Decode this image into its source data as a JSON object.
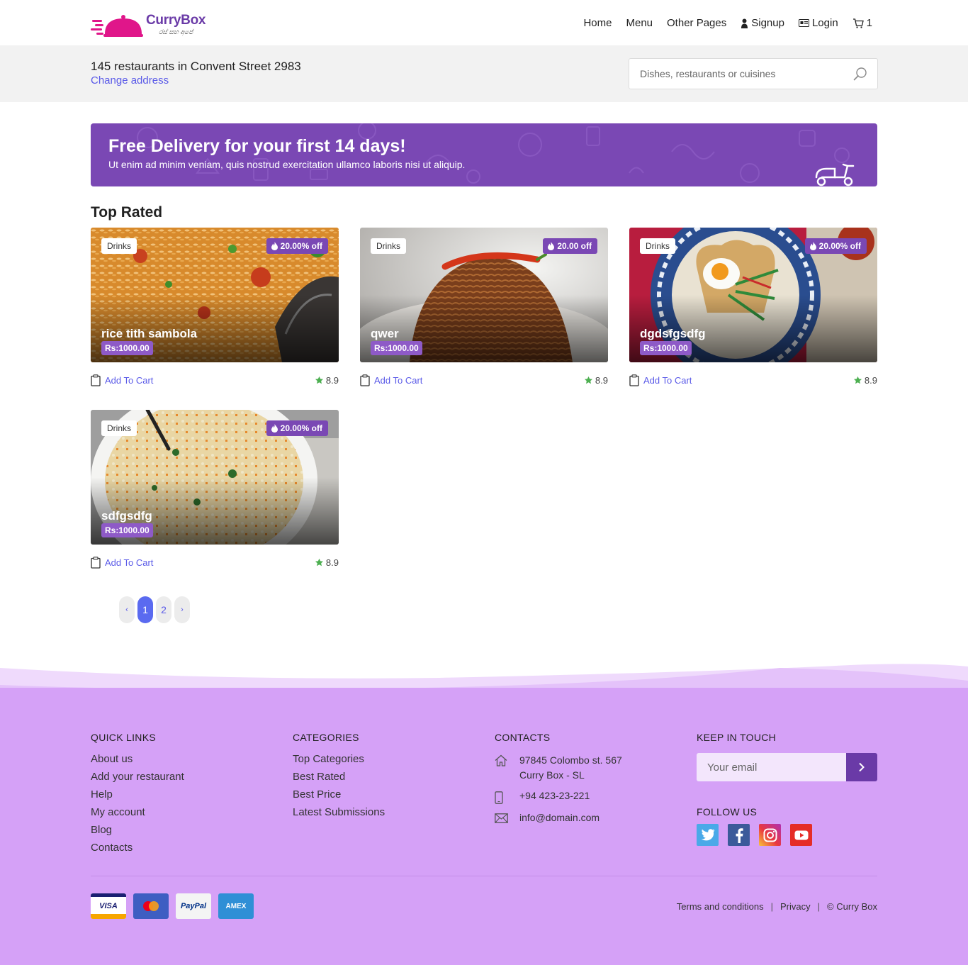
{
  "header": {
    "brand": "CurryBox",
    "tagline": "රස් සහ අපේ",
    "nav": {
      "home": "Home",
      "menu": "Menu",
      "other_pages": "Other Pages",
      "signup": "Signup",
      "login": "Login",
      "cart_count": "1"
    }
  },
  "address": {
    "title": "145 restaurants in Convent Street 2983",
    "change": "Change address",
    "search_placeholder": "Dishes, restaurants or cuisines"
  },
  "promo": {
    "title": "Free Delivery for your first 14 days!",
    "text": "Ut enim ad minim veniam, quis nostrud exercitation ullamco laboris nisi ut aliquip."
  },
  "section_title": "Top Rated",
  "items": [
    {
      "category": "Drinks",
      "offer": "20.00% off",
      "name": "rice tith sambola",
      "price": "Rs:1000.00",
      "add": "Add To Cart",
      "rating": "8.9"
    },
    {
      "category": "Drinks",
      "offer": "20.00 off",
      "name": "qwer",
      "price": "Rs:1000.00",
      "add": "Add To Cart",
      "rating": "8.9"
    },
    {
      "category": "Drinks",
      "offer": "20.00% off",
      "name": "dgdsfgsdfg",
      "price": "Rs:1000.00",
      "add": "Add To Cart",
      "rating": "8.9"
    },
    {
      "category": "Drinks",
      "offer": "20.00% off",
      "name": "sdfgsdfg",
      "price": "Rs:1000.00",
      "add": "Add To Cart",
      "rating": "8.9"
    }
  ],
  "pagination": {
    "prev": "‹",
    "pages": [
      "1",
      "2"
    ],
    "next": "›",
    "active": "1"
  },
  "footer": {
    "quick_links": {
      "title": "QUICK LINKS",
      "items": [
        "About us",
        "Add your restaurant",
        "Help",
        "My account",
        "Blog",
        "Contacts"
      ]
    },
    "categories": {
      "title": "CATEGORIES",
      "items": [
        "Top Categories",
        "Best Rated",
        "Best Price",
        "Latest Submissions"
      ]
    },
    "contacts": {
      "title": "CONTACTS",
      "address_line1": "97845 Colombo st. 567",
      "address_line2": "Curry Box - SL",
      "phone": "+94 423-23-221",
      "email": "info@domain.com"
    },
    "keep_in_touch": {
      "title": "KEEP IN TOUCH",
      "email_placeholder": "Your email"
    },
    "follow_us": {
      "title": "FOLLOW US"
    },
    "payments": [
      "VISA",
      "MasterCard",
      "PayPal",
      "AMEX"
    ],
    "legal": {
      "terms": "Terms and conditions",
      "privacy": "Privacy",
      "copyright": "© Curry Box"
    }
  },
  "colors": {
    "brand_purple": "#7a48b4",
    "link_blue": "#5a5ae8",
    "footer_bg": "#d5a1f7",
    "logo_pink": "#e0168a"
  }
}
